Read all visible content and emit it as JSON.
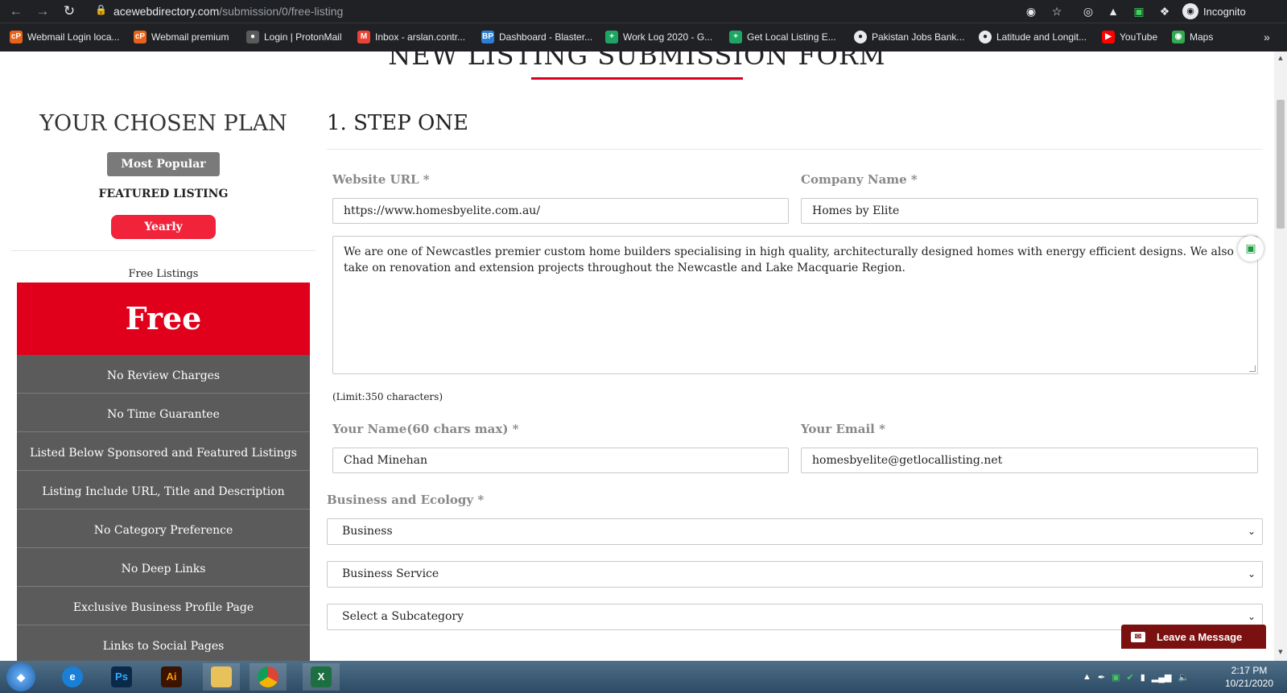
{
  "browser": {
    "url_host": "acewebdirectory.com",
    "url_path": "/submission/0/free-listing",
    "profile_label": "Incognito",
    "bookmarks": [
      {
        "label": "Webmail Login loca...",
        "icon": "cpanel-icon",
        "color": "#e8631a"
      },
      {
        "label": "Webmail premium",
        "icon": "cpanel-icon",
        "color": "#e8631a"
      },
      {
        "label": "Login | ProtonMail",
        "icon": "lock-icon",
        "color": "#e8eaed"
      },
      {
        "label": "Inbox - arslan.contr...",
        "icon": "gmail-icon",
        "color": "#ea4335"
      },
      {
        "label": "Dashboard - Blaster...",
        "icon": "bp-icon",
        "color": "#2a7fd4"
      },
      {
        "label": "Work Log 2020 - G...",
        "icon": "sheets-icon",
        "color": "#1fa463"
      },
      {
        "label": "Get Local Listing E...",
        "icon": "sheets-icon",
        "color": "#1fa463"
      },
      {
        "label": "Pakistan Jobs Bank...",
        "icon": "globe-icon",
        "color": "#e8eaed"
      },
      {
        "label": "Latitude and Longit...",
        "icon": "globe-icon",
        "color": "#e8eaed"
      },
      {
        "label": "YouTube",
        "icon": "youtube-icon",
        "color": "#ff0000"
      },
      {
        "label": "Maps",
        "icon": "maps-icon",
        "color": "#34a853"
      }
    ]
  },
  "page": {
    "heading": "NEW LISTING SUBMISSION FORM",
    "plan": {
      "title": "YOUR CHOSEN PLAN",
      "badge": "Most Popular",
      "name": "FEATURED LISTING",
      "billing": "Yearly",
      "free_label": "Free Listings",
      "price": "Free",
      "features": [
        "No Review Charges",
        "No Time Guarantee",
        "Listed Below Sponsored and Featured Listings",
        "Listing Include URL, Title and Description",
        "No Category Preference",
        "No Deep Links",
        "Exclusive Business Profile Page",
        "Links to Social Pages"
      ]
    },
    "form": {
      "step_title": "1. STEP ONE",
      "website_label": "Website URL *",
      "website_value": "https://www.homesbyelite.com.au/",
      "company_label": "Company Name *",
      "company_value": "Homes by Elite",
      "description": "We are one of Newcastles premier custom home builders specialising in high quality, architecturally designed homes with energy efficient designs. We also take on renovation and extension projects throughout the Newcastle and Lake Macquarie Region.",
      "limit_note": "(Limit:350 characters)",
      "name_label": "Your Name(60 chars max) *",
      "name_value": "Chad Minehan",
      "email_label": "Your Email *",
      "email_value": "homesbyelite@getlocallisting.net",
      "category_label": "Business and Ecology *",
      "category_value": "Business",
      "subcat1_value": "Business Service",
      "subcat2_value": "Select a Subcategory"
    },
    "chat": {
      "label": "Leave a Message"
    }
  },
  "taskbar": {
    "apps": [
      {
        "name": "edge-icon",
        "label": "e",
        "color": "#1a7fd6"
      },
      {
        "name": "photoshop-icon",
        "label": "Ps",
        "color": "#0b2a4a"
      },
      {
        "name": "illustrator-icon",
        "label": "Ai",
        "color": "#3b1300"
      },
      {
        "name": "file-explorer-icon",
        "label": "",
        "color": "#e8c15a"
      },
      {
        "name": "chrome-icon",
        "label": "",
        "color": "#db4437"
      },
      {
        "name": "excel-icon",
        "label": "X",
        "color": "#1d6f42"
      }
    ],
    "time": "2:17 PM",
    "date": "10/21/2020"
  }
}
